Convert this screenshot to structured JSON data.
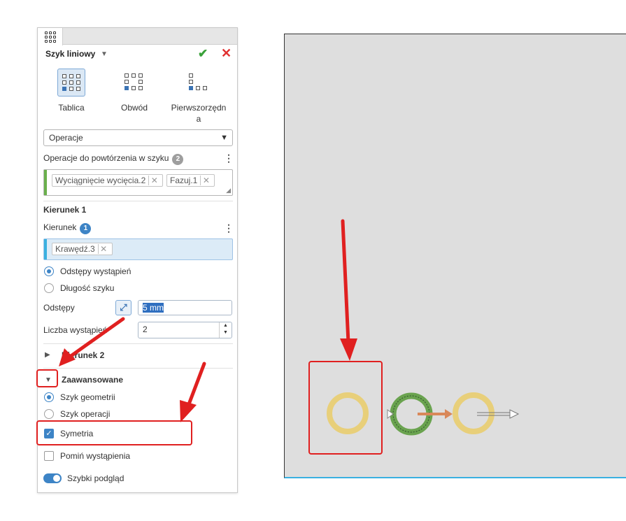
{
  "panel": {
    "title": "Szyk liniowy",
    "patterns": [
      {
        "label": "Tablica",
        "selected": true
      },
      {
        "label": "Obwód",
        "selected": false
      },
      {
        "label": "Pierwszorzędn a",
        "selected": false
      }
    ],
    "pattern_type": "Operacje",
    "ops_label": "Operacje do powtórzenia w szyku",
    "ops_count": "2",
    "ops_chips": [
      "Wyciągnięcie wycięcia.2",
      "Fazuj.1"
    ],
    "dir1": {
      "title": "Kierunek 1",
      "field_label": "Kierunek",
      "field_count": "1",
      "chip": "Krawędź.3",
      "opt_spacing": "Odstępy wystąpień",
      "opt_length": "Długość szyku",
      "spacing_label": "Odstępy",
      "spacing_value": "5 mm",
      "count_label": "Liczba wystąpień",
      "count_value": "2"
    },
    "dir2_title": "Kierunek 2",
    "advanced": {
      "title": "Zaawansowane",
      "opt_geometry": "Szyk geometrii",
      "opt_operation": "Szyk operacji",
      "symmetry_label": "Symetria",
      "symmetry_checked": true,
      "skip_label": "Pomiń wystąpienia",
      "skip_checked": false
    },
    "preview_label": "Szybki podgląd",
    "preview_on": true
  },
  "colors": {
    "accent": "#3d84c6",
    "annotation": "#e02020",
    "ok": "#3aa13a",
    "cancel": "#e03030"
  }
}
